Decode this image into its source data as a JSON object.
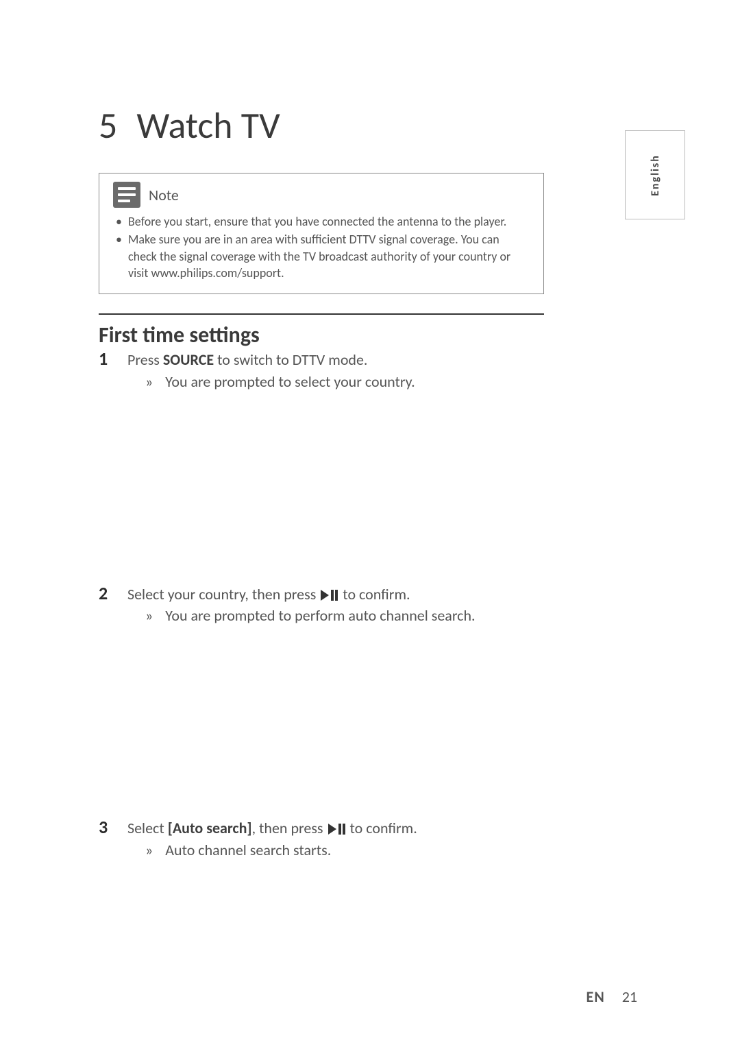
{
  "chapter": {
    "number": "5",
    "title": "Watch TV"
  },
  "language_tab": "English",
  "note": {
    "label": "Note",
    "bullets": [
      "Before you start, ensure that you have connected the antenna to the player.",
      "Make sure you are in an area with sufficient DTTV signal coverage. You can check the signal coverage with the TV broadcast authority of your country or visit www.philips.com/support."
    ]
  },
  "section_heading": "First time settings",
  "steps": [
    {
      "num": "1",
      "instr_pre": "Press ",
      "instr_bold": "SOURCE",
      "instr_post": " to switch to DTTV mode.",
      "sub_arrow": "»",
      "sub_text": "You are prompted to select your country."
    },
    {
      "num": "2",
      "instr_pre": "Select your country, then press ",
      "instr_bold": "",
      "instr_post_icon": " to confirm.",
      "has_icon": true,
      "sub_arrow": "»",
      "sub_text": "You are prompted to perform auto channel search."
    },
    {
      "num": "3",
      "instr_pre": "Select ",
      "instr_bold": "[Auto search]",
      "instr_mid": ", then press ",
      "instr_post_icon": " to confirm.",
      "has_icon": true,
      "sub_arrow": "»",
      "sub_text": "Auto channel search starts."
    }
  ],
  "footer": {
    "lang": "EN",
    "page": "21"
  }
}
